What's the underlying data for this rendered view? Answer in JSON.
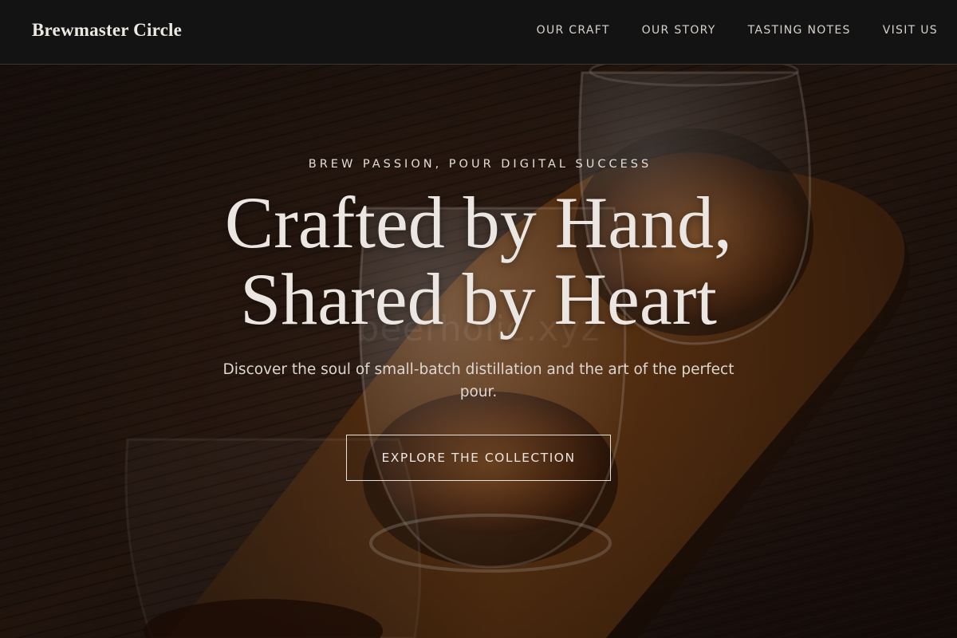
{
  "header": {
    "brand": "Brewmaster Circle",
    "nav": [
      {
        "label": "OUR CRAFT"
      },
      {
        "label": "OUR STORY"
      },
      {
        "label": "TASTING NOTES"
      },
      {
        "label": "VISIT US"
      }
    ]
  },
  "hero": {
    "eyebrow": "BREW PASSION, POUR DIGITAL SUCCESS",
    "headline_line1": "Crafted by Hand,",
    "headline_line2": "Shared by Heart",
    "watermark": "beerholic.xyz",
    "subtext": "Discover the soul of small-batch distillation and the art of the perfect pour.",
    "cta_label": "EXPLORE THE COLLECTION",
    "background": "photo-whiskey-flight-on-wooden-paddle"
  },
  "colors": {
    "header_bg": "#131313",
    "text_light": "#ebe6e1",
    "wood": "#6b3a17",
    "whiskey": "#8a4612"
  }
}
